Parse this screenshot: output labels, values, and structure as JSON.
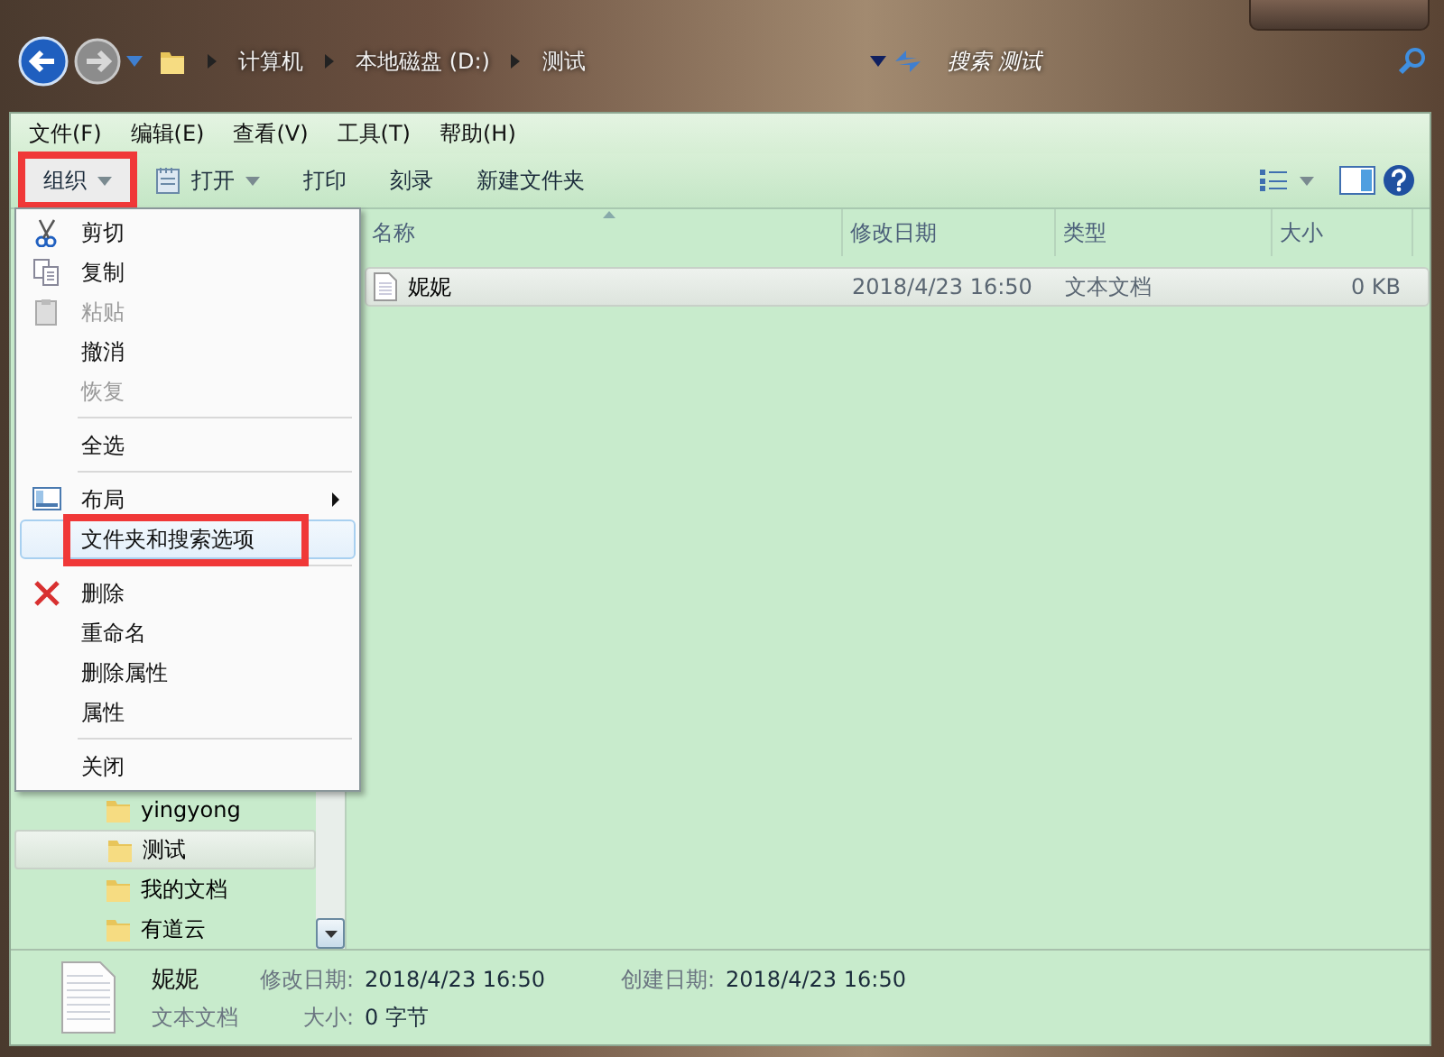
{
  "address_bar": {
    "path": [
      "计算机",
      "本地磁盘 (D:)",
      "测试"
    ],
    "search": {
      "placeholder": "搜索 测试"
    }
  },
  "menu_bar": [
    "文件(F)",
    "编辑(E)",
    "查看(V)",
    "工具(T)",
    "帮助(H)"
  ],
  "toolbar": {
    "buttons": [
      {
        "label": "组织",
        "kind": "dropdown",
        "highlighted": true
      },
      {
        "label": "打开",
        "kind": "icon-dropdown",
        "highlighted": false
      },
      {
        "label": "打印",
        "kind": "plain",
        "highlighted": false
      },
      {
        "label": "刻录",
        "kind": "plain",
        "highlighted": false
      },
      {
        "label": "新建文件夹",
        "kind": "plain",
        "highlighted": false
      }
    ]
  },
  "organize_menu": {
    "items": [
      {
        "kind": "item",
        "label": "剪切",
        "disabled": false,
        "selected": false,
        "submenu": false,
        "highlighted": false
      },
      {
        "kind": "item",
        "label": "复制",
        "disabled": false,
        "selected": false,
        "submenu": false,
        "highlighted": false
      },
      {
        "kind": "item",
        "label": "粘贴",
        "disabled": true,
        "selected": false,
        "submenu": false,
        "highlighted": false
      },
      {
        "kind": "item",
        "label": "撤消",
        "disabled": false,
        "selected": false,
        "submenu": false,
        "highlighted": false
      },
      {
        "kind": "item",
        "label": "恢复",
        "disabled": true,
        "selected": false,
        "submenu": false,
        "highlighted": false
      },
      {
        "kind": "separator"
      },
      {
        "kind": "item",
        "label": "全选",
        "disabled": false,
        "selected": false,
        "submenu": false,
        "highlighted": false
      },
      {
        "kind": "separator"
      },
      {
        "kind": "item",
        "label": "布局",
        "disabled": false,
        "selected": false,
        "submenu": true,
        "highlighted": false
      },
      {
        "kind": "item",
        "label": "文件夹和搜索选项",
        "disabled": false,
        "selected": true,
        "submenu": false,
        "highlighted": true
      },
      {
        "kind": "separator"
      },
      {
        "kind": "item",
        "label": "删除",
        "disabled": false,
        "selected": false,
        "submenu": false,
        "highlighted": false
      },
      {
        "kind": "item",
        "label": "重命名",
        "disabled": false,
        "selected": false,
        "submenu": false,
        "highlighted": false
      },
      {
        "kind": "item",
        "label": "删除属性",
        "disabled": false,
        "selected": false,
        "submenu": false,
        "highlighted": false
      },
      {
        "kind": "item",
        "label": "属性",
        "disabled": false,
        "selected": false,
        "submenu": false,
        "highlighted": false
      },
      {
        "kind": "separator"
      },
      {
        "kind": "item",
        "label": "关闭",
        "disabled": false,
        "selected": false,
        "submenu": false,
        "highlighted": false
      }
    ]
  },
  "nav_pane": {
    "items": [
      {
        "label": "yingyong",
        "selected": false
      },
      {
        "label": "测试",
        "selected": true
      },
      {
        "label": "我的文档",
        "selected": false
      },
      {
        "label": "有道云",
        "selected": false
      }
    ]
  },
  "file_list": {
    "columns": [
      {
        "label": "名称",
        "sorted": true
      },
      {
        "label": "修改日期",
        "sorted": false
      },
      {
        "label": "类型",
        "sorted": false
      },
      {
        "label": "大小",
        "sorted": false
      }
    ],
    "rows": [
      {
        "name": "妮妮",
        "modified": "2018/4/23 16:50",
        "type": "文本文档",
        "size": "0 KB",
        "selected": true
      }
    ]
  },
  "details": {
    "name": "妮妮",
    "type": "文本文档",
    "fields": [
      {
        "label": "修改日期:",
        "value": "2018/4/23 16:50"
      },
      {
        "label": "创建日期:",
        "value": "2018/4/23 16:50"
      },
      {
        "label": "大小:",
        "value": "0 字节"
      }
    ]
  }
}
